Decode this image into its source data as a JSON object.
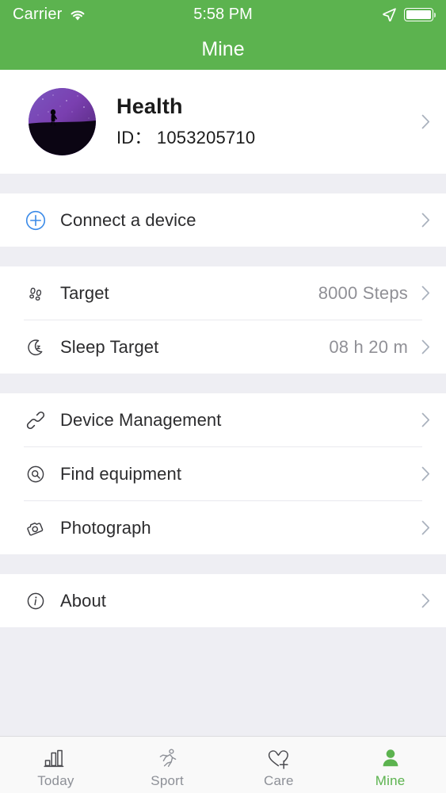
{
  "theme": {
    "brand_green": "#5cb34f",
    "page_background": "#eeeef3",
    "card_background": "#ffffff",
    "value_text": "#909096",
    "chevron": "#a9b1bd",
    "accent_blue": "#3a8ae8"
  },
  "status_bar": {
    "carrier": "Carrier",
    "time": "5:58 PM",
    "wifi_icon": "wifi-icon",
    "location_icon": "location-arrow-icon",
    "battery_icon": "battery-full-icon"
  },
  "navbar": {
    "title": "Mine"
  },
  "profile": {
    "name": "Health",
    "id_label": "ID：",
    "id_value": "1053205710",
    "id_full": "ID： 1053205710",
    "avatar_icon": "avatar-night-walker",
    "chevron_icon": "chevron-right-icon"
  },
  "sections": [
    {
      "name": "connect",
      "rows": [
        {
          "key": "connect_device",
          "icon": "plus-circle-icon",
          "label": "Connect a device",
          "value": ""
        }
      ]
    },
    {
      "name": "targets",
      "rows": [
        {
          "key": "target",
          "icon": "footprints-icon",
          "label": "Target",
          "value": "8000 Steps"
        },
        {
          "key": "sleep_target",
          "icon": "moon-icon",
          "label": "Sleep Target",
          "value": "08 h 20 m"
        }
      ]
    },
    {
      "name": "device",
      "rows": [
        {
          "key": "device_management",
          "icon": "link-icon",
          "label": "Device Management",
          "value": ""
        },
        {
          "key": "find_equipment",
          "icon": "find-device-icon",
          "label": "Find equipment",
          "value": ""
        },
        {
          "key": "photograph",
          "icon": "camera-icon",
          "label": "Photograph",
          "value": ""
        }
      ]
    },
    {
      "name": "info",
      "rows": [
        {
          "key": "about",
          "icon": "info-circle-icon",
          "label": "About",
          "value": ""
        }
      ]
    }
  ],
  "tabbar": {
    "items": [
      {
        "key": "today",
        "label": "Today",
        "icon": "bar-chart-icon",
        "active": false
      },
      {
        "key": "sport",
        "label": "Sport",
        "icon": "running-person-icon",
        "active": false
      },
      {
        "key": "care",
        "label": "Care",
        "icon": "heart-plus-icon",
        "active": false
      },
      {
        "key": "mine",
        "label": "Mine",
        "icon": "person-icon",
        "active": true
      }
    ]
  }
}
